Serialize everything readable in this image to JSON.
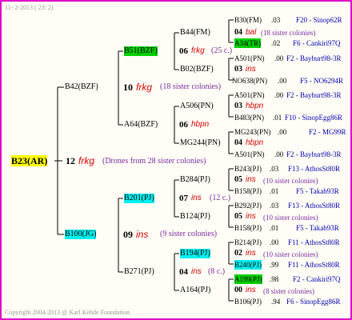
{
  "header": {
    "date_line": "11-  2-2013 ( 23:  2)"
  },
  "footer": {
    "copyright": "Copyright 2004-2013 @ Karl Kehde Foundation."
  },
  "root": {
    "label": "B23(AR)",
    "gen": "12",
    "frkg": "frkg",
    "note": "(Drones from 28 sister colonies)"
  },
  "gen1": [
    {
      "label": "B42(BZF)",
      "gen": "10",
      "tag": "frkg",
      "note": "(18 sister colonies)"
    },
    {
      "label": "B100(JG)",
      "gen": "09",
      "tag": "ins",
      "note": "(9 sister colonies)"
    }
  ],
  "gen2": [
    {
      "label": "B51(BZF)",
      "gen": "06",
      "tag": "frkg",
      "note": "(25 c.)"
    },
    {
      "label": "A64(BZF)",
      "gen": "06",
      "tag": "hbpn",
      "note": ""
    },
    {
      "label": "B201(PJ)",
      "gen": "07",
      "tag": "ins",
      "note": "(12 c.)"
    },
    {
      "label": "B271(PJ)",
      "gen": "04",
      "tag": "ins",
      "note": "(8 c.)"
    }
  ],
  "gen3": [
    {
      "label": "B44(FM)",
      "gen": "04",
      "tag": "bal",
      "note": "(18 sister colonies)"
    },
    {
      "label": "B02(BZF)",
      "gen": "03",
      "tag": "ins",
      "note": ""
    },
    {
      "label": "A506(PN)",
      "gen": "03",
      "tag": "hbpn",
      "note": ""
    },
    {
      "label": "MG244(PN)",
      "gen": "04",
      "tag": "hbpn",
      "note": ""
    },
    {
      "label": "B284(PJ)",
      "gen": "05",
      "tag": "ins",
      "note": "(10 sister colonies)"
    },
    {
      "label": "B124(PJ)",
      "gen": "05",
      "tag": "ins",
      "note": "(10 sister colonies)"
    },
    {
      "label": "B194(PJ)",
      "gen": "02",
      "tag": "ins",
      "note": "(10 sister colonies)"
    },
    {
      "label": "A164(PJ)",
      "gen": "00",
      "tag": "ins",
      "note": "(8 sister colonies)"
    }
  ],
  "gen4": [
    {
      "label": "B30(FM)",
      "num": ".03",
      "code": "F20 - Sinop62R"
    },
    {
      "label": "A34(TR)",
      "num": ".02",
      "code": "F6 - Cankiri97Q"
    },
    {
      "label": "A501(PN)",
      "num": ".00",
      "code": "F2 - Bayburt98-3R"
    },
    {
      "label": "NO638(PN)",
      "num": ".00",
      "code": "F5 - NO6294R"
    },
    {
      "label": "A501(PN)",
      "num": ".00",
      "code": "F2 - Bayburt98-3R"
    },
    {
      "label": "B483(PN)",
      "num": ".01",
      "code": "F10 - SinopEgg86R"
    },
    {
      "label": "MG243(PN)",
      "num": ".00",
      "code": "F2 - MG99R"
    },
    {
      "label": "A501(PN)",
      "num": ".00",
      "code": "F2 - Bayburt98-3R"
    },
    {
      "label": "B243(PJ)",
      "num": ".03",
      "code": "F13 - AthosSt80R"
    },
    {
      "label": "B158(PJ)",
      "num": ".01",
      "code": "F5 - Takab93R"
    },
    {
      "label": "B292(PJ)",
      "num": ".03",
      "code": "F13 - AthosSt80R"
    },
    {
      "label": "B158(PJ)",
      "num": ".01",
      "code": "F5 - Takab93R"
    },
    {
      "label": "B214(PJ)",
      "num": ".00",
      "code": "F11 - AthosSt80R"
    },
    {
      "label": "B240(PJ)",
      "num": ".99",
      "code": "F11 - AthosSt80R"
    },
    {
      "label": "A199(PJ)",
      "num": ".98",
      "code": "F2 - Cankiri97Q"
    },
    {
      "label": "B106(PJ)",
      "num": ".94",
      "code": "F6 - SinopEgg86R"
    }
  ]
}
